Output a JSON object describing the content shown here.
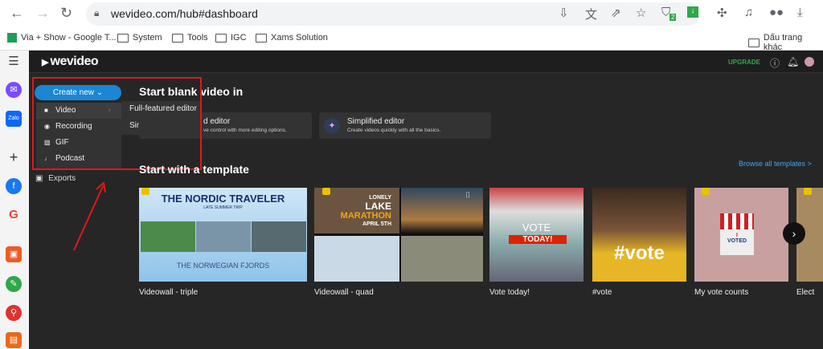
{
  "browser": {
    "url": "wevideo.com/hub#dashboard",
    "extension_badge": "2",
    "bookmarks": [
      "Via + Show - Google T...",
      "System",
      "Tools",
      "IGC",
      "Xams Solution"
    ],
    "other_bookmarks": "Dấu trang khác"
  },
  "app": {
    "logo": "wevideo",
    "upgrade": "UPGRADE"
  },
  "menu": {
    "create_new": "Create new",
    "items": [
      {
        "label": "Video",
        "icon": "video-icon"
      },
      {
        "label": "Recording",
        "icon": "record-icon"
      },
      {
        "label": "GIF",
        "icon": "gif-icon"
      },
      {
        "label": "Podcast",
        "icon": "music-note-icon"
      }
    ],
    "submenu": [
      "Full-featured editor",
      "Simplified editor"
    ],
    "exports": "Exports"
  },
  "blank": {
    "title": "Start blank video in",
    "cards": [
      {
        "title": "d editor",
        "sub": "ve control with more editing options."
      },
      {
        "title": "Simplified editor",
        "sub": "Create videos quickly with all the basics."
      }
    ]
  },
  "templates": {
    "title": "Start with a template",
    "browse": "Browse all templates >",
    "items": [
      {
        "label": "Videowall - triple",
        "texts": [
          "THE NORDIC TRAVELER",
          "LATE SUMMER TRIP",
          "THE NORWEGIAN FJORDS"
        ]
      },
      {
        "label": "Videowall - quad",
        "texts": [
          "LONELY",
          "LAKE",
          "MARATHON",
          "APRIL 5TH"
        ]
      },
      {
        "label": "Vote today!",
        "texts": [
          "VOTE",
          "TODAY!"
        ]
      },
      {
        "label": "#vote",
        "texts": [
          "#vote"
        ]
      },
      {
        "label": "My vote counts",
        "texts": [
          "I",
          "VOTED"
        ]
      },
      {
        "label": "Elect",
        "texts": []
      }
    ]
  },
  "colors": {
    "accent": "#1b86d3",
    "upgrade": "#2ea84a",
    "annotation": "#e01818",
    "background": "#262626"
  }
}
